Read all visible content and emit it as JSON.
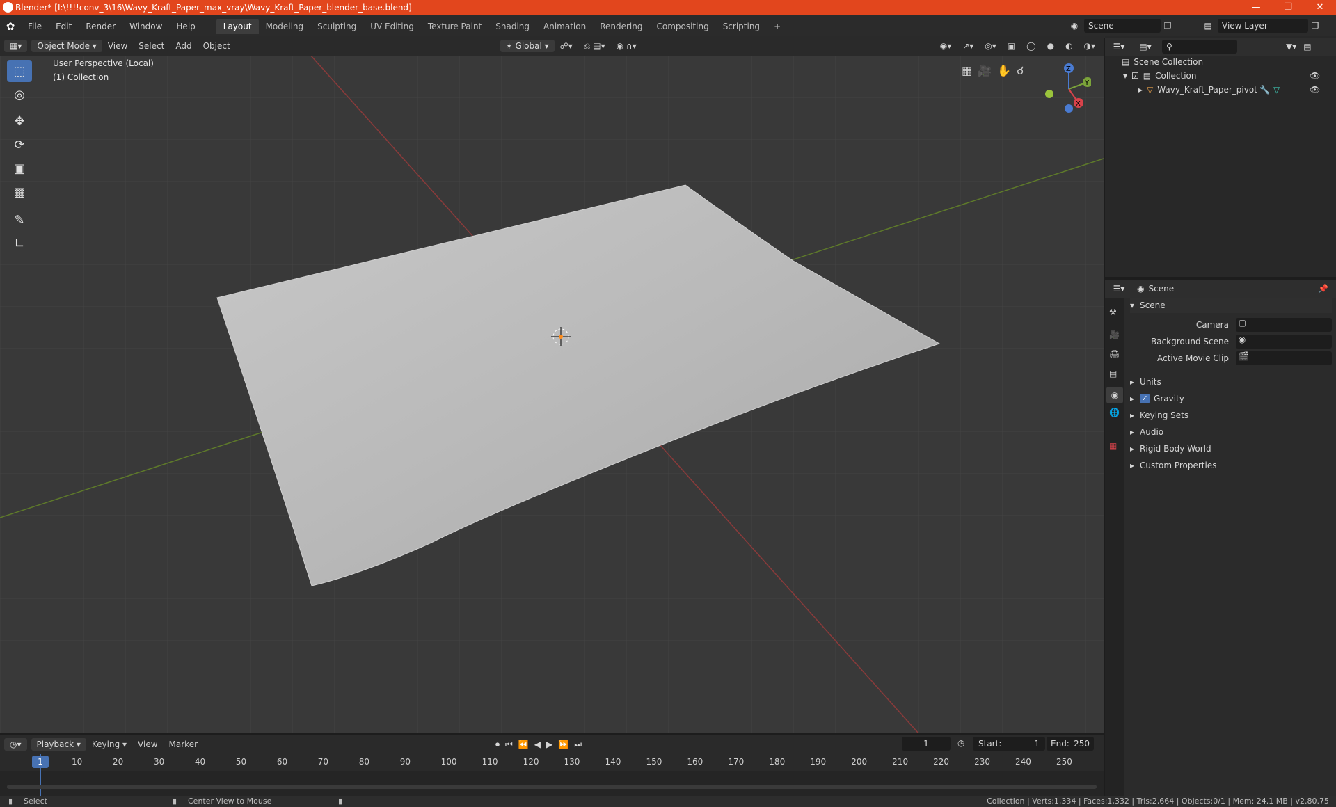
{
  "title_bar": {
    "title": "Blender* [I:\\!!!!conv_3\\16\\Wavy_Kraft_Paper_max_vray\\Wavy_Kraft_Paper_blender_base.blend]"
  },
  "menu": [
    "File",
    "Edit",
    "Render",
    "Window",
    "Help"
  ],
  "workspaces": [
    "Layout",
    "Modeling",
    "Sculpting",
    "UV Editing",
    "Texture Paint",
    "Shading",
    "Animation",
    "Rendering",
    "Compositing",
    "Scripting"
  ],
  "scene_name": "Scene",
  "view_layer": "View Layer",
  "viewport_header": {
    "mode": "Object Mode",
    "menus": [
      "View",
      "Select",
      "Add",
      "Object"
    ],
    "orientation": "Global"
  },
  "viewport": {
    "perspective": "User Perspective (Local)",
    "collection": "(1) Collection"
  },
  "outliner": {
    "root": "Scene Collection",
    "collection": "Collection",
    "object": "Wavy_Kraft_Paper_pivot"
  },
  "properties": {
    "context": "Scene",
    "panel": "Scene",
    "camera_label": "Camera",
    "background_scene_label": "Background Scene",
    "active_movie_clip_label": "Active Movie Clip",
    "sections": [
      "Units",
      "Gravity",
      "Keying Sets",
      "Audio",
      "Rigid Body World",
      "Custom Properties"
    ]
  },
  "timeline": {
    "menus": [
      "Playback",
      "Keying",
      "View",
      "Marker"
    ],
    "current_frame": "1",
    "start_label": "Start:",
    "start": "1",
    "end_label": "End:",
    "end": "250",
    "ticks": [
      "1",
      "10",
      "20",
      "30",
      "40",
      "50",
      "60",
      "70",
      "80",
      "90",
      "100",
      "110",
      "120",
      "130",
      "140",
      "150",
      "160",
      "170",
      "180",
      "190",
      "200",
      "210",
      "220",
      "230",
      "240",
      "250"
    ]
  },
  "status": {
    "select": "Select",
    "center": "Center View to Mouse",
    "info": "Collection | Verts:1,334 | Faces:1,332 | Tris:2,664 | Objects:0/1 | Mem: 24.1 MB | v2.80.75"
  }
}
